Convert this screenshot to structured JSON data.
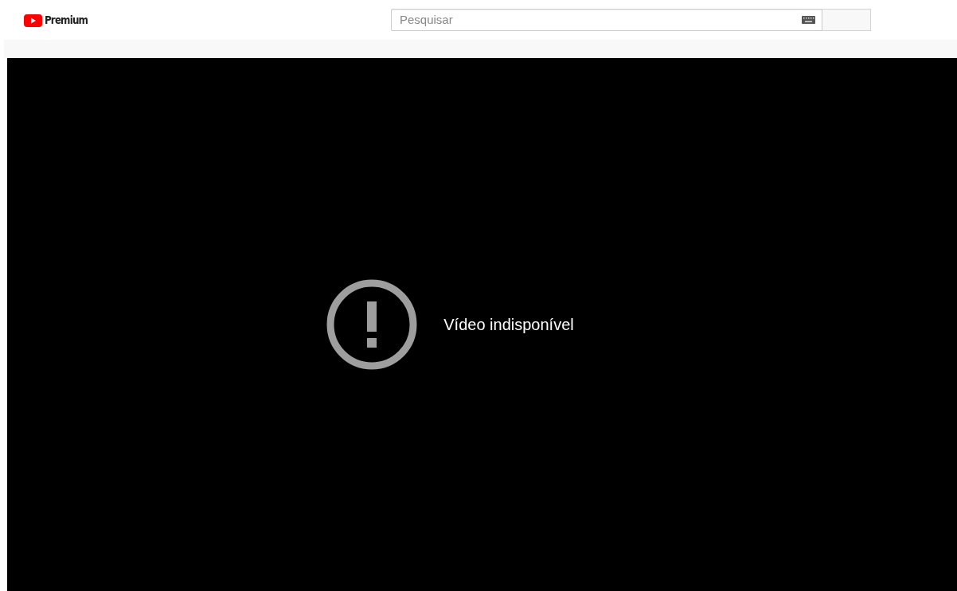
{
  "header": {
    "logo_text": "Premium",
    "search": {
      "placeholder": "Pesquisar"
    }
  },
  "player": {
    "message": "Vídeo indisponível"
  }
}
